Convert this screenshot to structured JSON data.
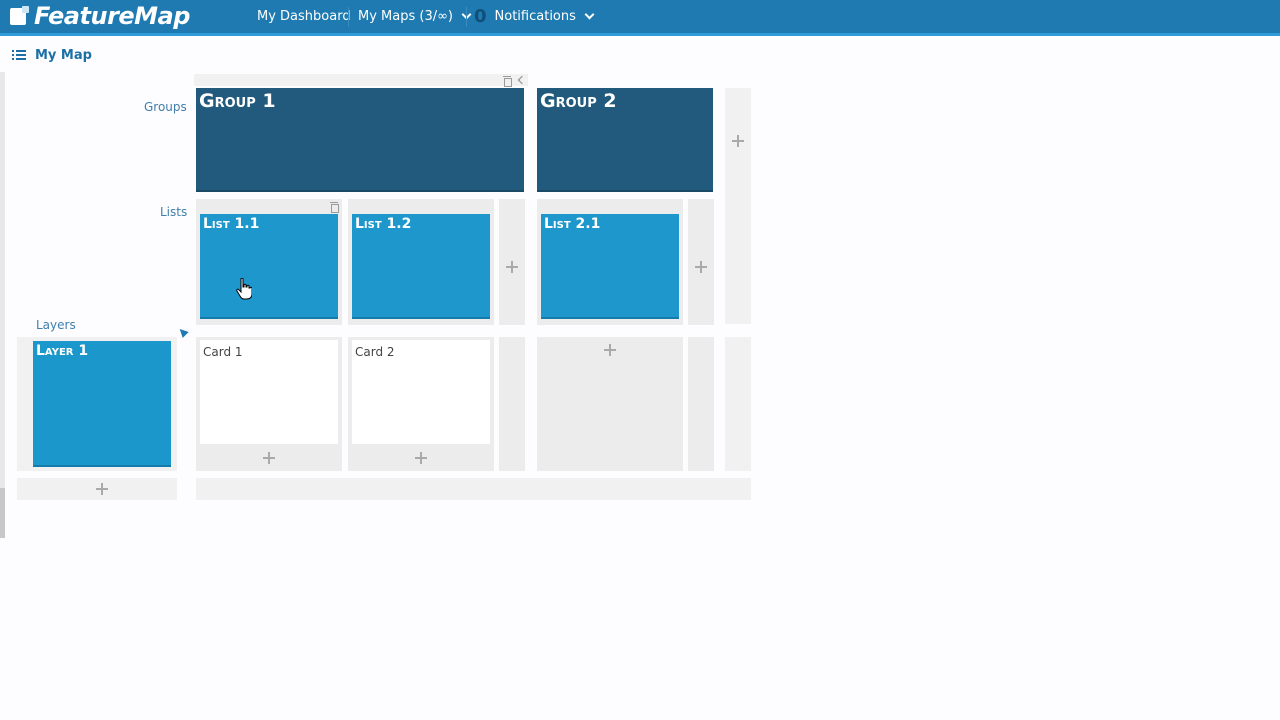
{
  "app": {
    "logo_text": "FeatureMap"
  },
  "nav": {
    "dashboard_label": "My Dashboard",
    "maps_label": "My Maps (3/∞)",
    "notifications_count": "0",
    "notifications_label": "Notifications"
  },
  "page": {
    "title": "My Map"
  },
  "rows": {
    "groups_label": "Groups",
    "lists_label": "Lists",
    "layers_label": "Layers"
  },
  "groups": [
    {
      "name": "Group 1"
    },
    {
      "name": "Group 2"
    }
  ],
  "lists": [
    {
      "name": "List 1.1"
    },
    {
      "name": "List 1.2"
    },
    {
      "name": "List 2.1"
    }
  ],
  "layers": [
    {
      "name": "Layer 1"
    }
  ],
  "cards": [
    {
      "name": "Card 1"
    },
    {
      "name": "Card 2"
    }
  ],
  "colors": {
    "topbar": "#1e7ab0",
    "group_tile": "#215a7c",
    "list_tile": "#1d97cc",
    "label": "#3f7fae"
  }
}
